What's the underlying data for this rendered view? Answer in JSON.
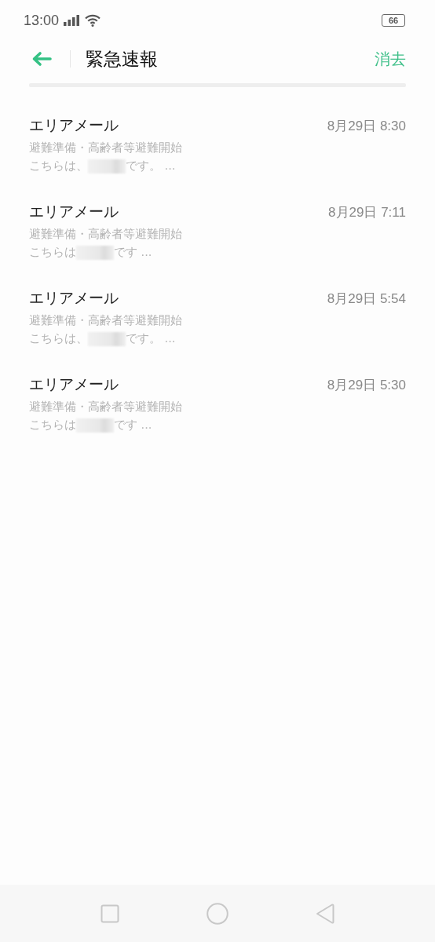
{
  "status_bar": {
    "time": "13:00",
    "battery": "66"
  },
  "header": {
    "title": "緊急速報",
    "action": "消去"
  },
  "messages": [
    {
      "sender": "エリアメール",
      "time": "8月29日 8:30",
      "subject": "避難準備・高齢者等避難開始",
      "preview_before": "こちらは、",
      "preview_after": "です。 ..."
    },
    {
      "sender": "エリアメール",
      "time": "8月29日 7:11",
      "subject": "避難準備・高齢者等避難開始",
      "preview_before": "こちらは",
      "preview_after": "です ..."
    },
    {
      "sender": "エリアメール",
      "time": "8月29日 5:54",
      "subject": "避難準備・高齢者等避難開始",
      "preview_before": "こちらは、",
      "preview_after": "です。 ..."
    },
    {
      "sender": "エリアメール",
      "time": "8月29日 5:30",
      "subject": "避難準備・高齢者等避難開始",
      "preview_before": "こちらは",
      "preview_after": "です ..."
    }
  ]
}
